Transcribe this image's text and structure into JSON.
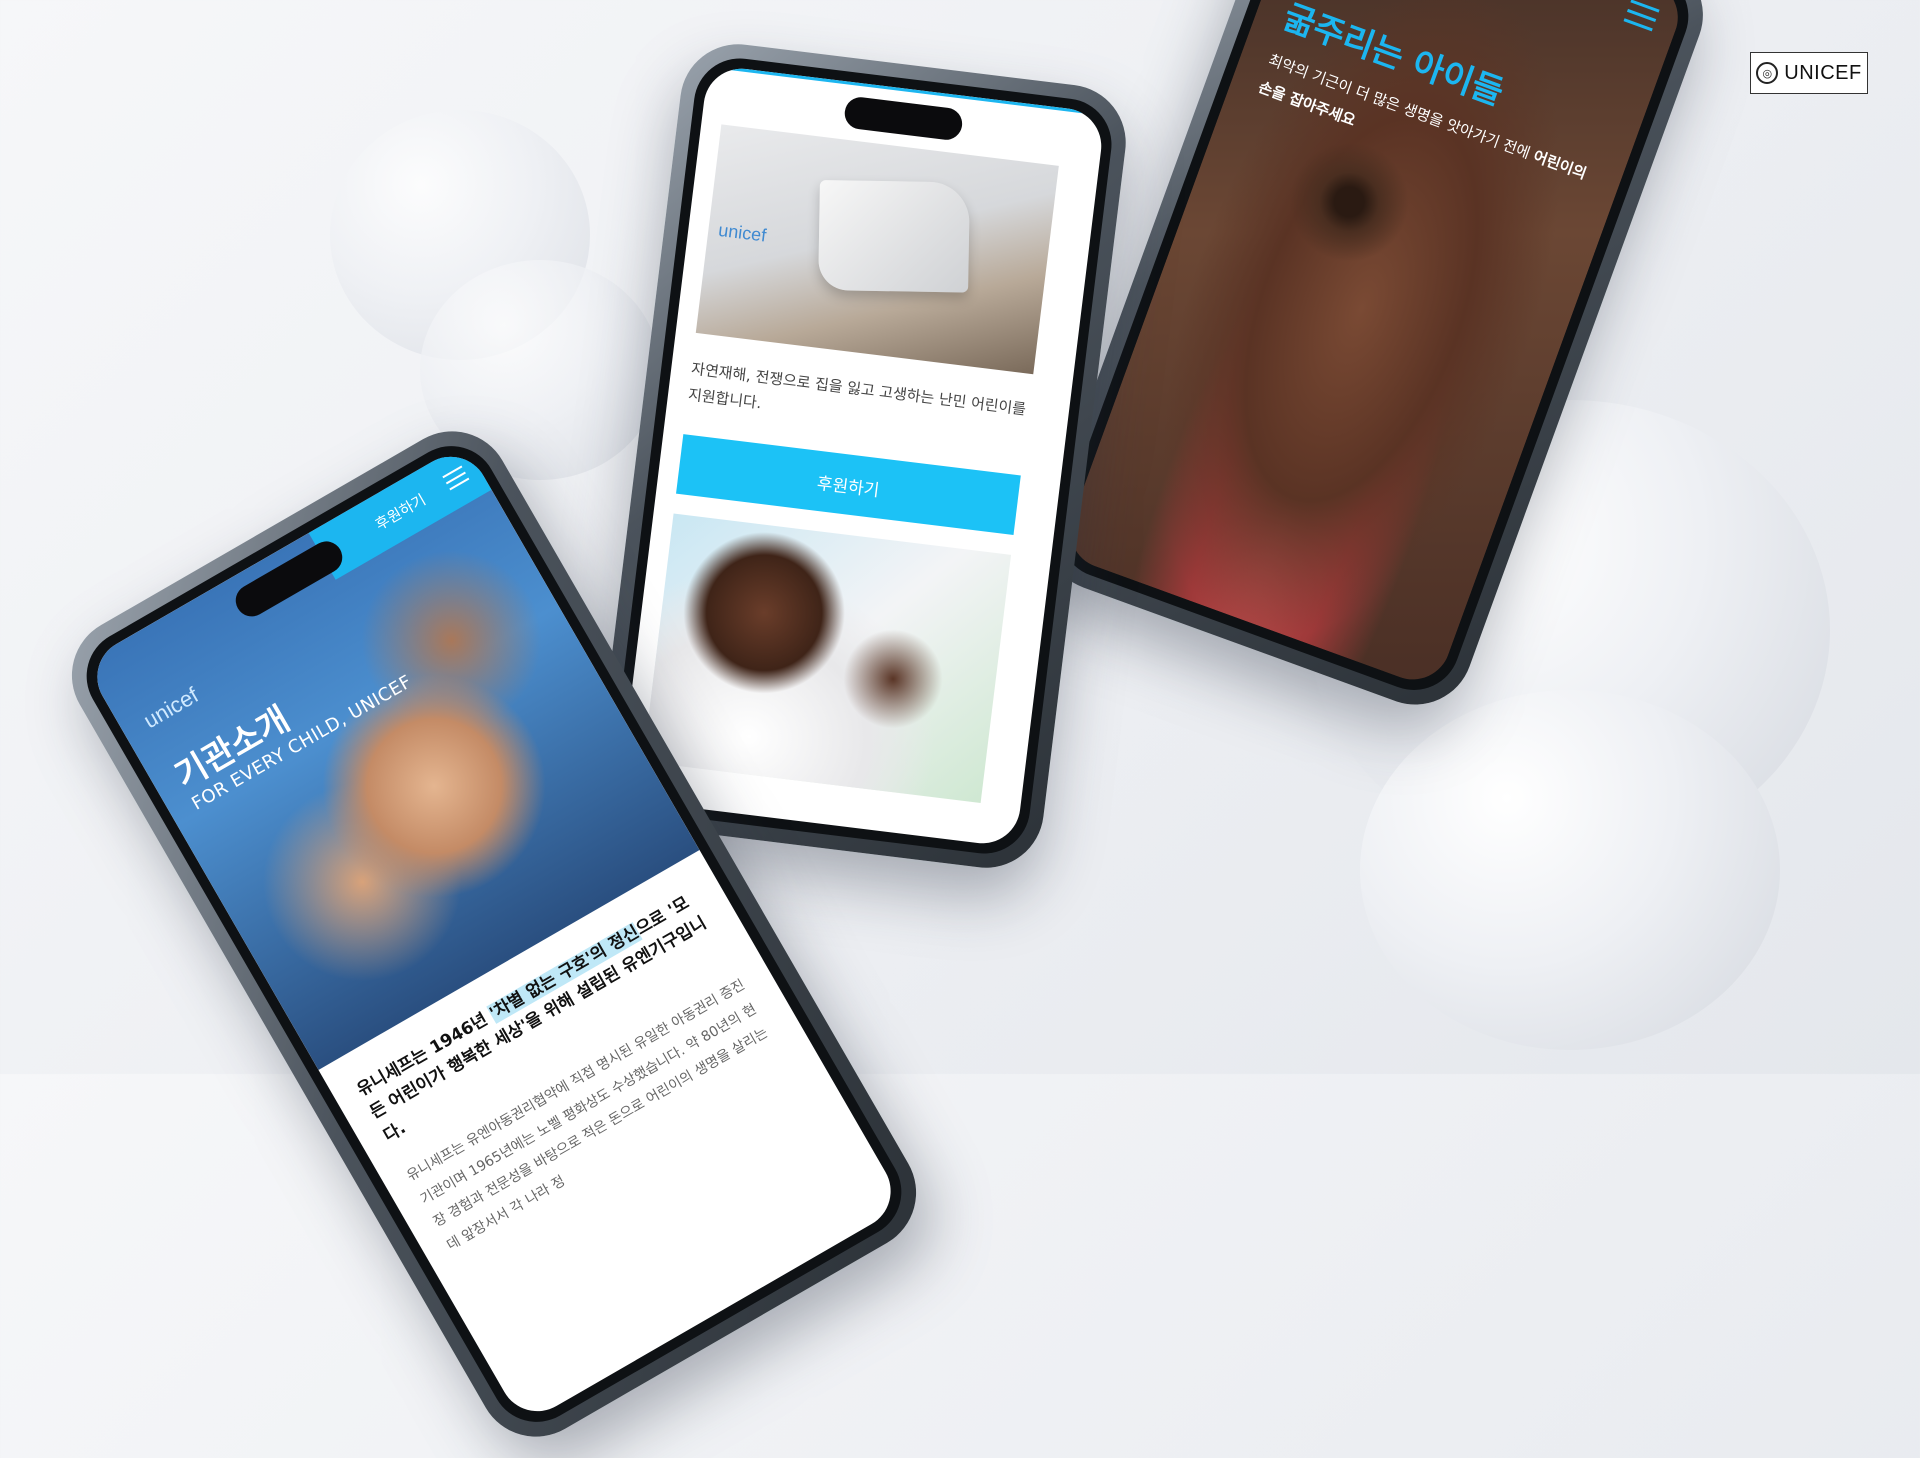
{
  "brand": {
    "label": "UNICEF",
    "icon": "unicef-emblem-icon"
  },
  "phone_left": {
    "cta_label": "후원하기",
    "logo_text": "unicef",
    "title": "기관소개",
    "subtitle": "FOR EVERY CHILD, UNICEF",
    "lead_pre": "유니세프는 1946년 ",
    "lead_highlight": "'차별 없는 구호'의 정신",
    "lead_post": "으로 '모든 어린이가 행복한 세상'을 위해 설립된 유엔기구입니다.",
    "paragraph": "유니세프는 유엔아동권리협약에 직접 명시된 유일한 아동권리 증진 기관이며 1965년에는 노벨 평화상도 수상했습니다. 약 80년의 현장 경험과 전문성을 바탕으로 적은 돈으로 어린이의 생명을 살리는데 앞장서서 각 나라 정"
  },
  "phone_middle": {
    "image_tag": "unicef",
    "description": "자연재해, 전쟁으로 집을 잃고 고생하는 난민 어린이를 지원합니다.",
    "donate_button": "후원하기"
  },
  "phone_right": {
    "headline": "굶주리는 아이들",
    "sub_pre": "최악의 기근이 더 많은 생명을 앗아가기 전에 ",
    "sub_bold": "어린이의 손을 잡아주세요"
  },
  "colors": {
    "accent": "#1cb6f0",
    "highlight": "#bfe8f7"
  }
}
